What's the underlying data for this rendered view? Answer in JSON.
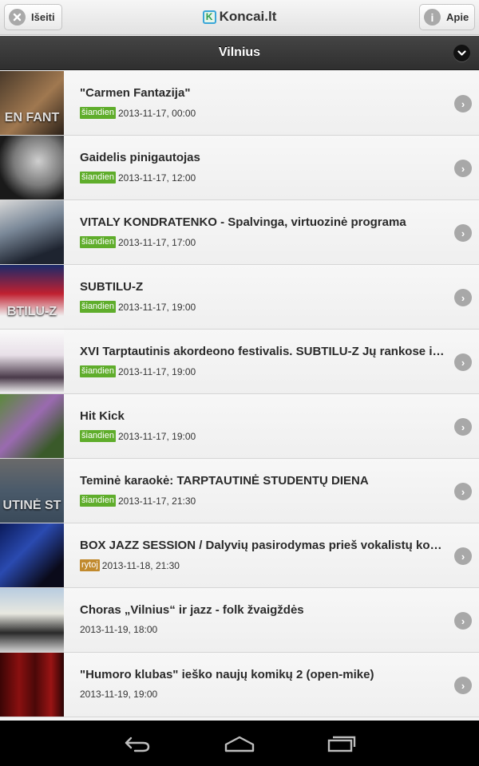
{
  "header": {
    "exit_label": "Išeiti",
    "exit_icon": "close-icon",
    "logo_mark": "K",
    "logo_text": "Koncai.lt",
    "about_label": "Apie",
    "about_icon": "info-icon",
    "about_glyph": "i"
  },
  "city": {
    "title": "Vilnius",
    "chevron": "⌄"
  },
  "events": [
    {
      "title": "\"Carmen Fantazija\"",
      "badge": "šiandien",
      "badge_type": "today",
      "datetime": "2013-11-17, 00:00",
      "thumb_text": "EN FANT",
      "thumb_bg": "linear-gradient(135deg,#4a3a2a,#a07850 55%,#2a2018)"
    },
    {
      "title": "Gaidelis pinigautojas",
      "badge": "šiandien",
      "badge_type": "today",
      "datetime": "2013-11-17, 12:00",
      "thumb_text": "",
      "thumb_bg": "radial-gradient(circle at 60% 40%,#cfcfcf,#7a7a7a 45%,#1a1a1a 75%)"
    },
    {
      "title": "VITALY KONDRATENKO - Spalvinga, virtuozinė programa",
      "badge": "šiandien",
      "badge_type": "today",
      "datetime": "2013-11-17, 17:00",
      "thumb_text": "",
      "thumb_bg": "linear-gradient(160deg,#d8d8d8,#7a8898 40%,#1e2430 80%)"
    },
    {
      "title": "SUBTILU-Z",
      "badge": "šiandien",
      "badge_type": "today",
      "datetime": "2013-11-17, 19:00",
      "thumb_text": "BTILU-Z",
      "thumb_bg": "linear-gradient(180deg,#1a2a6a,#c02030 45%,#f0f0f0 80%)"
    },
    {
      "title": "XVI Tarptautinis akordeono festivalis. SUBTILU-Z Jų rankose i…",
      "badge": "šiandien",
      "badge_type": "today",
      "datetime": "2013-11-17, 19:00",
      "thumb_text": "",
      "thumb_bg": "linear-gradient(180deg,#fafafa,#e8e0e8 40%,#4a3a4a 75%,#f4f4f4)"
    },
    {
      "title": "Hit Kick",
      "badge": "šiandien",
      "badge_type": "today",
      "datetime": "2013-11-17, 19:00",
      "thumb_text": "",
      "thumb_bg": "linear-gradient(135deg,#5a8a3a,#9a6ab0 45%,#3a5a2a 80%)"
    },
    {
      "title": "Teminė karaokė: TARPTAUTINĖ STUDENTŲ DIENA",
      "badge": "šiandien",
      "badge_type": "today",
      "datetime": "2013-11-17, 21:30",
      "thumb_text": "UTINĖ ST",
      "thumb_bg": "linear-gradient(180deg,#6a6a6a,#4a5a6a 50%,#3a4a5a)"
    },
    {
      "title": "BOX JAZZ SESSION / Dalyvių pasirodymas prieš vokalistų kon…",
      "badge": "rytoj",
      "badge_type": "tomorrow",
      "datetime": "2013-11-18, 21:30",
      "thumb_text": "",
      "thumb_bg": "linear-gradient(135deg,#0a1a5a,#2a4ab0 40%,#0a0a1a 80%)"
    },
    {
      "title": "Choras „Vilnius“ ir jazz - folk žvaigždės",
      "badge": "",
      "badge_type": "none",
      "datetime": "2013-11-19, 18:00",
      "thumb_text": "",
      "thumb_bg": "linear-gradient(180deg,#b8cce0,#e8e8e0 40%,#2a2a2a 70%,#d0d0d0)"
    },
    {
      "title": "\"Humoro klubas\" ieško naujų komikų 2 (open-mike)",
      "badge": "",
      "badge_type": "none",
      "datetime": "2013-11-19, 19:00",
      "thumb_text": "",
      "thumb_bg": "linear-gradient(90deg,#3a0505,#8a1010 30%,#4a0808 55%,#9a1414 80%,#2a0404)"
    }
  ],
  "row_arrow": "›",
  "nav": {
    "back_icon": "back-icon",
    "home_icon": "home-icon",
    "recents_icon": "recent-apps-icon"
  }
}
